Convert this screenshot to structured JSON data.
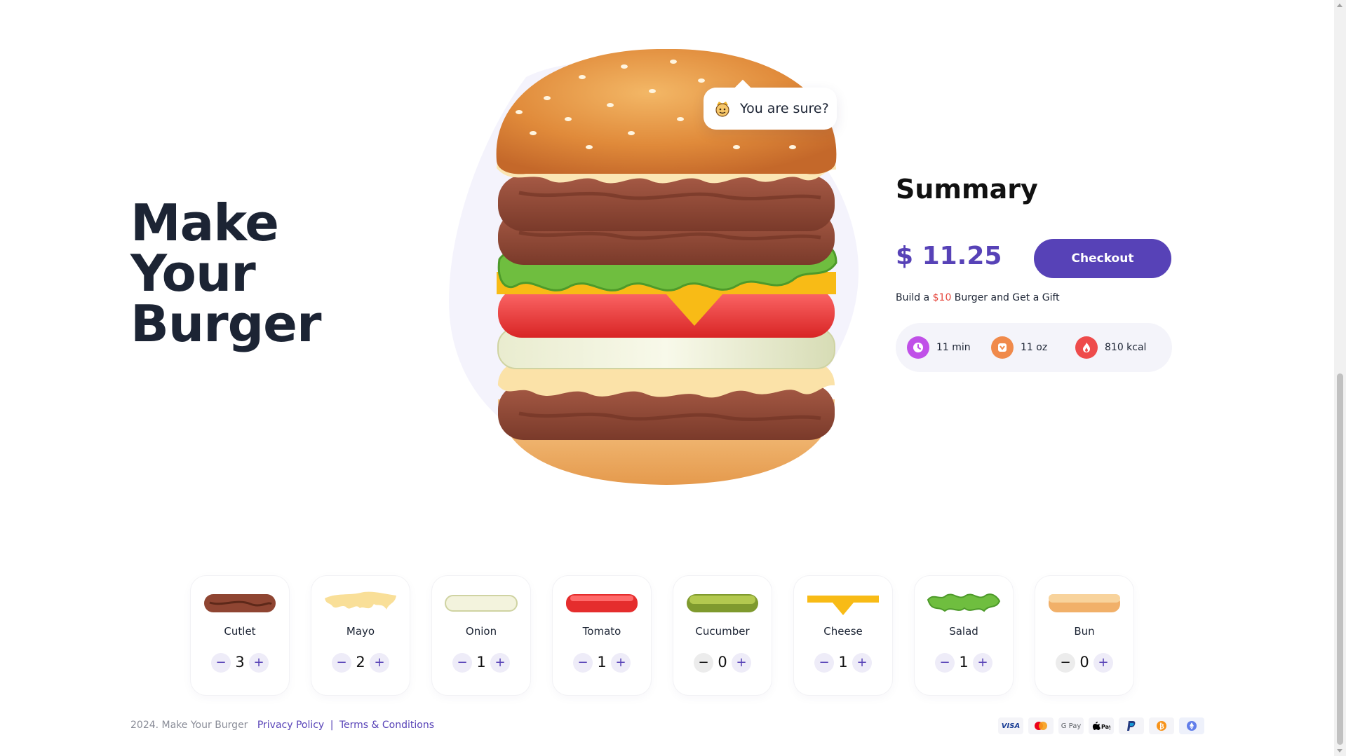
{
  "hero": {
    "title_lines": [
      "Make",
      "Your",
      "Burger"
    ]
  },
  "tooltip": {
    "text": "You are sure?",
    "icon": "chef-face-icon"
  },
  "summary": {
    "title": "Summary",
    "price": "$ 11.25",
    "checkout_label": "Checkout",
    "promo_prefix": "Build a ",
    "promo_highlight": "$10",
    "promo_suffix": " Burger and Get a Gift",
    "stats": [
      {
        "icon": "clock-icon",
        "value": "11 min",
        "color": "#c050e8"
      },
      {
        "icon": "weight-icon",
        "value": "11 oz",
        "color": "#f08a4b"
      },
      {
        "icon": "fire-icon",
        "value": "810 kcal",
        "color": "#ee4b4b"
      }
    ]
  },
  "ingredients": [
    {
      "name": "Cutlet",
      "count": "3"
    },
    {
      "name": "Mayo",
      "count": "2"
    },
    {
      "name": "Onion",
      "count": "1"
    },
    {
      "name": "Tomato",
      "count": "1"
    },
    {
      "name": "Cucumber",
      "count": "0"
    },
    {
      "name": "Cheese",
      "count": "1"
    },
    {
      "name": "Salad",
      "count": "1"
    },
    {
      "name": "Bun",
      "count": "0"
    }
  ],
  "controls": {
    "minus": "−",
    "plus": "+"
  },
  "footer": {
    "copyright": "2024. Make Your Burger",
    "privacy": "Privacy Policy",
    "separator": "|",
    "terms": "Terms & Conditions",
    "payments": [
      "VISA",
      "mastercard",
      "G Pay",
      "Apple Pay",
      "PayPal",
      "bitcoin",
      "ethereum"
    ]
  },
  "colors": {
    "accent": "#5742b7",
    "text": "#1c2434",
    "promo": "#e6473d"
  }
}
